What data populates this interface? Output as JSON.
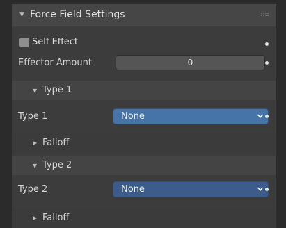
{
  "panel": {
    "title": "Force Field Settings",
    "collapse_icon": "triangle-down-icon",
    "grip_icon": "drag-grip-icon"
  },
  "self_effect": {
    "label": "Self Effect",
    "checked": false
  },
  "effector_amount": {
    "label": "Effector Amount",
    "value": "0"
  },
  "type1": {
    "section_title": "Type 1",
    "label": "Type 1",
    "selected": "None",
    "falloff_label": "Falloff"
  },
  "type2": {
    "section_title": "Type 2",
    "label": "Type 2",
    "selected": "None",
    "falloff_label": "Falloff"
  },
  "colors": {
    "panel_bg": "#3c3c3c",
    "header_bg": "#464646",
    "select_bg": "#4673a8",
    "field_bg": "#555555"
  }
}
